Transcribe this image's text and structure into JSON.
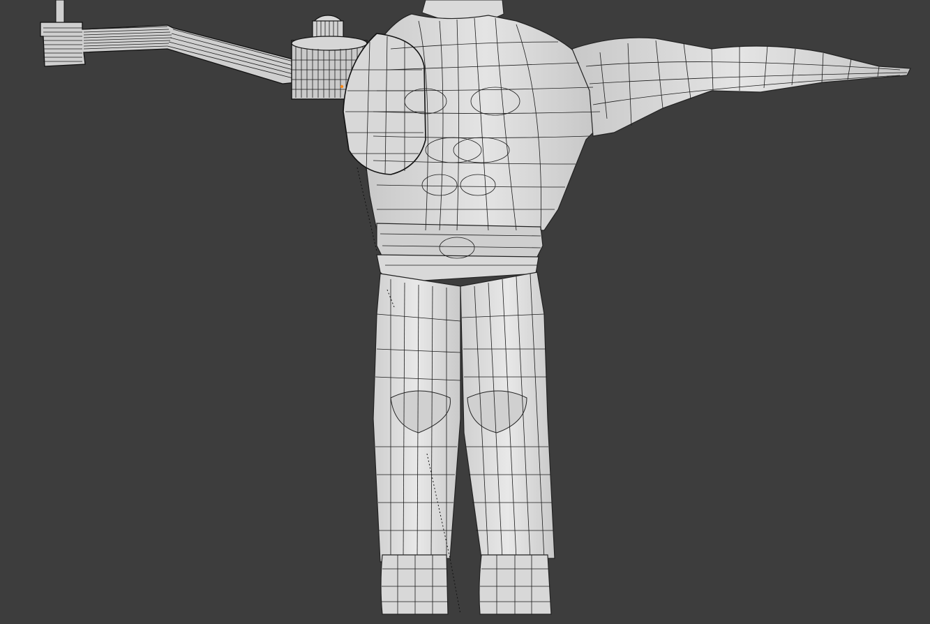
{
  "viewport": {
    "background_color": "#3d3d3d",
    "mesh_color": "#d6d6d6",
    "wire_color": "#1a1a1a",
    "selected_vertex_color": "#ff8c1a",
    "content": "3d-wireframe-mesh-character-t-pose"
  }
}
